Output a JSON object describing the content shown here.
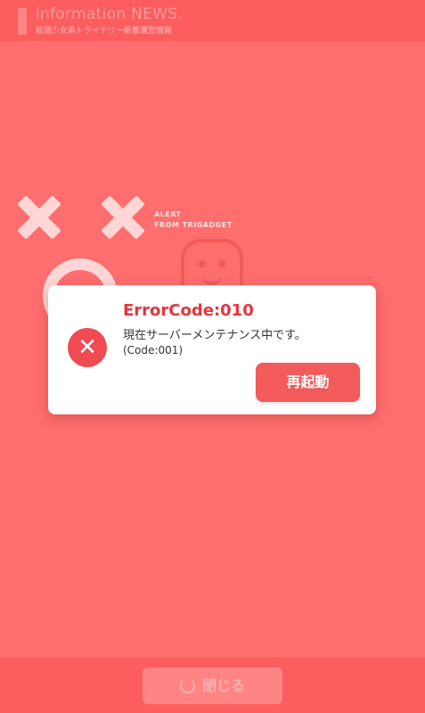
{
  "header": {
    "title": "information NEWS.",
    "subtitle": "拡張少女系トライナリー新着運営情報"
  },
  "background": {
    "alert_line1": "ALERT",
    "alert_line2": "FROM TRIGADGET"
  },
  "dialog": {
    "icon": "error-x-icon",
    "title": "ErrorCode:010",
    "message": "現在サーバーメンテナンス中です。",
    "code": "(Code:001)",
    "restart_label": "再起動"
  },
  "footer": {
    "close_label": "閉じる",
    "close_icon": "spinner-icon"
  },
  "colors": {
    "background": "#fe6e6e",
    "header": "#fc5d5f",
    "accent": "#f25a5c",
    "error_text": "#e8333c"
  }
}
